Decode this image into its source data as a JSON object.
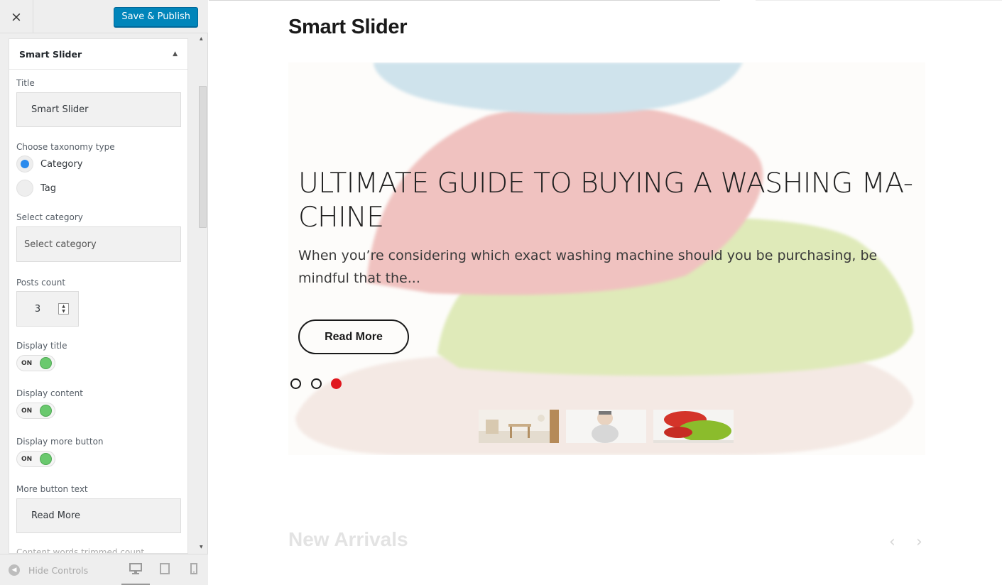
{
  "topbar": {
    "close_icon": "×",
    "publish_label": "Save & Publish"
  },
  "panel": {
    "title": "Smart Slider",
    "collapse_icon": "▲",
    "title_label": "Title",
    "title_value": "Smart Slider",
    "taxonomy_label": "Choose taxonomy type",
    "taxonomy_options": [
      "Category",
      "Tag"
    ],
    "taxonomy_selected": "Category",
    "category_label": "Select category",
    "category_placeholder": "Select category",
    "posts_count_label": "Posts count",
    "posts_count_value": "3",
    "display_title_label": "Display title",
    "display_content_label": "Display content",
    "display_more_label": "Display more button",
    "toggle_state": "ON",
    "more_text_label": "More button text",
    "more_text_value": "Read More",
    "trimmed_label": "Content words trimmed count"
  },
  "bottombar": {
    "hide_controls": "Hide Controls",
    "collapse_icon": "◀",
    "devices": [
      "desktop-icon",
      "tablet-icon",
      "mobile-icon"
    ],
    "active_device": "desktop"
  },
  "preview": {
    "site_title": "Smart Slider",
    "slide": {
      "heading": "ULTIMATE GUIDE TO BUYING A WASHING MA-CHINE",
      "text": "When you’re considering which exact washing machine should you be purchasing, be mindful that the...",
      "button": "Read More",
      "dots_count": 3,
      "active_dot": 3
    },
    "thumbnails": [
      "room-thumbnail",
      "baby-thumbnail",
      "pillows-thumbnail"
    ],
    "section_title": "New Arrivals",
    "prev_icon": "‹",
    "next_icon": "›"
  },
  "colors": {
    "accent": "#0085ba",
    "active_dot": "#e0181f",
    "toggle_on": "#6ac96e",
    "radio_on": "#2b8bed"
  }
}
